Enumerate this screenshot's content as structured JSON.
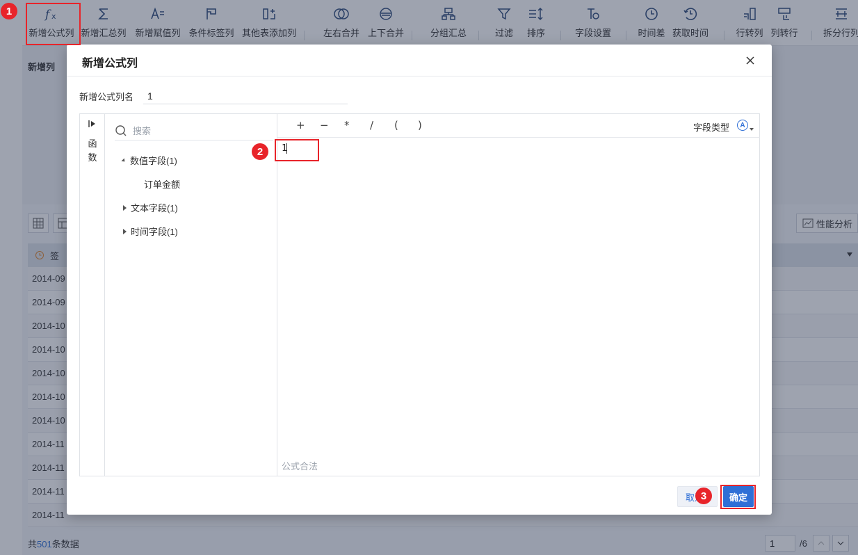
{
  "toolbar": {
    "items": [
      {
        "label": "新增公式列",
        "icon": "fx-icon"
      },
      {
        "label": "新增汇总列",
        "icon": "sigma-icon"
      },
      {
        "label": "新增赋值列",
        "icon": "assign-icon"
      },
      {
        "label": "条件标签列",
        "icon": "flag-icon"
      },
      {
        "label": "其他表添加列",
        "icon": "add-column-icon"
      },
      {
        "label": "左右合并",
        "icon": "merge-horizontal-icon"
      },
      {
        "label": "上下合并",
        "icon": "merge-vertical-icon"
      },
      {
        "label": "分组汇总",
        "icon": "group-icon"
      },
      {
        "label": "过滤",
        "icon": "filter-icon"
      },
      {
        "label": "排序",
        "icon": "sort-icon"
      },
      {
        "label": "字段设置",
        "icon": "field-settings-icon"
      },
      {
        "label": "时间差",
        "icon": "time-diff-icon"
      },
      {
        "label": "获取时间",
        "icon": "get-time-icon"
      },
      {
        "label": "行转列",
        "icon": "row-to-col-icon"
      },
      {
        "label": "列转行",
        "icon": "col-to-row-icon"
      },
      {
        "label": "拆分行列",
        "icon": "split-icon"
      }
    ]
  },
  "background": {
    "section_title": "新增列",
    "perf_button": "性能分析",
    "table_header_first": "签",
    "rows": [
      "2014-09",
      "2014-09",
      "2014-10",
      "2014-10",
      "2014-10",
      "2014-10",
      "2014-10",
      "2014-11",
      "2014-11",
      "2014-11",
      "2014-11"
    ],
    "footer_prefix": "共",
    "footer_count": "501",
    "footer_suffix": "条数据",
    "pager_current": "1",
    "pager_total": "/6"
  },
  "dialog": {
    "title": "新增公式列",
    "name_label": "新增公式列名",
    "name_value": "1",
    "func_tab_label": "函数",
    "search_placeholder": "搜索",
    "tree": [
      {
        "label": "数值字段(1)",
        "expanded": true,
        "children": [
          "订单金额"
        ]
      },
      {
        "label": "文本字段(1)",
        "expanded": false,
        "children": []
      },
      {
        "label": "时间字段(1)",
        "expanded": false,
        "children": []
      }
    ],
    "operators": [
      "+",
      "−",
      "*",
      "/",
      "(",
      ")"
    ],
    "field_type_label": "字段类型",
    "field_type_icon": "Ⓐ",
    "formula": "1",
    "validity": "公式合法",
    "cancel_label": "取消",
    "ok_label": "确定"
  },
  "annotations": {
    "badges": [
      "1",
      "2",
      "3"
    ],
    "color": "#e8242a"
  },
  "colors": {
    "accent": "#2f6fd6",
    "overlay": "rgba(40,52,78,0.45)"
  }
}
